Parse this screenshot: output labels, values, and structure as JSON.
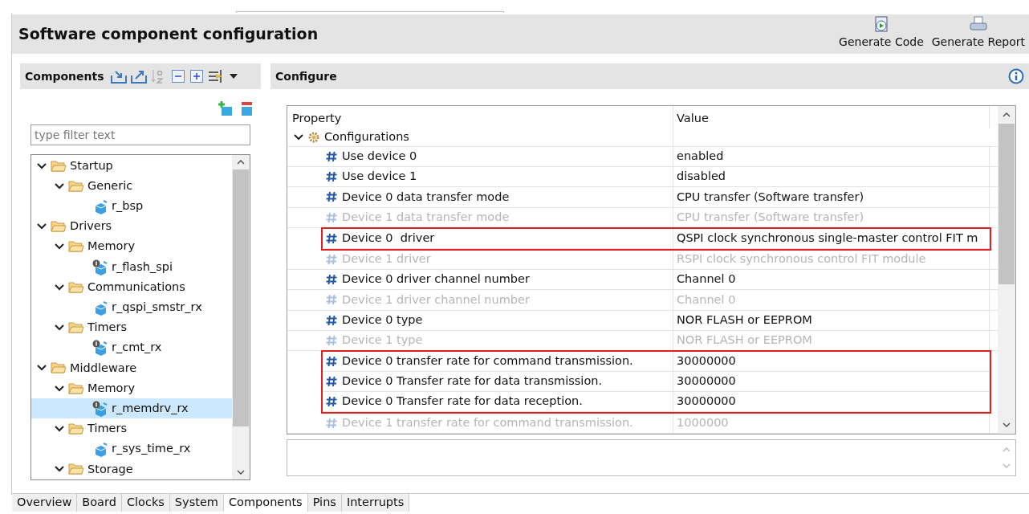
{
  "header": {
    "title": "Software component configuration",
    "actions": [
      {
        "label": "Generate Code",
        "kind": "code"
      },
      {
        "label": "Generate Report",
        "kind": "report"
      }
    ]
  },
  "components_panel": {
    "title": "Components",
    "filter": {
      "placeholder": "type filter text"
    },
    "tree": [
      {
        "label": "Startup",
        "kind": "folder",
        "expanded": true,
        "selected": false,
        "children": [
          {
            "label": "Generic",
            "kind": "folder",
            "expanded": true,
            "selected": false,
            "children": [
              {
                "label": "r_bsp",
                "kind": "component",
                "badge": false,
                "selected": false
              }
            ]
          }
        ]
      },
      {
        "label": "Drivers",
        "kind": "folder",
        "expanded": true,
        "selected": false,
        "children": [
          {
            "label": "Memory",
            "kind": "folder",
            "expanded": true,
            "selected": false,
            "children": [
              {
                "label": "r_flash_spi",
                "kind": "component",
                "badge": true,
                "selected": false
              }
            ]
          },
          {
            "label": "Communications",
            "kind": "folder",
            "expanded": true,
            "selected": false,
            "children": [
              {
                "label": "r_qspi_smstr_rx",
                "kind": "component",
                "badge": false,
                "selected": false
              }
            ]
          },
          {
            "label": "Timers",
            "kind": "folder",
            "expanded": true,
            "selected": false,
            "children": [
              {
                "label": "r_cmt_rx",
                "kind": "component",
                "badge": true,
                "selected": false
              }
            ]
          }
        ]
      },
      {
        "label": "Middleware",
        "kind": "folder",
        "expanded": true,
        "selected": false,
        "children": [
          {
            "label": "Memory",
            "kind": "folder",
            "expanded": true,
            "selected": false,
            "children": [
              {
                "label": "r_memdrv_rx",
                "kind": "component",
                "badge": true,
                "selected": true
              }
            ]
          },
          {
            "label": "Timers",
            "kind": "folder",
            "expanded": true,
            "selected": false,
            "children": [
              {
                "label": "r_sys_time_rx",
                "kind": "component",
                "badge": false,
                "selected": false
              }
            ]
          },
          {
            "label": "Storage",
            "kind": "folder",
            "expanded": true,
            "selected": false
          }
        ]
      }
    ]
  },
  "configure_panel": {
    "title": "Configure",
    "columns": [
      "Property",
      "Value"
    ],
    "group": {
      "label": "Configurations",
      "expanded": true
    },
    "rows": [
      {
        "property": "Use device 0",
        "value": "enabled",
        "disabled": false,
        "highlighted": false
      },
      {
        "property": "Use device 1",
        "value": "disabled",
        "disabled": false,
        "highlighted": false
      },
      {
        "property": "Device 0 data transfer mode",
        "value": "CPU transfer (Software transfer)",
        "disabled": false,
        "highlighted": false
      },
      {
        "property": "Device 1 data transfer mode",
        "value": "CPU transfer (Software transfer)",
        "disabled": true,
        "highlighted": false
      },
      {
        "property": "Device 0  driver",
        "value": "QSPI clock synchronous single-master control FIT m",
        "disabled": false,
        "highlighted": true
      },
      {
        "property": "Device 1 driver",
        "value": "RSPI clock synchronous control FIT module",
        "disabled": true,
        "highlighted": false
      },
      {
        "property": "Device 0 driver channel number",
        "value": "Channel 0",
        "disabled": false,
        "highlighted": false
      },
      {
        "property": "Device 1 driver channel number",
        "value": "Channel 0",
        "disabled": true,
        "highlighted": false
      },
      {
        "property": "Device 0 type",
        "value": "NOR FLASH or EEPROM",
        "disabled": false,
        "highlighted": false
      },
      {
        "property": "Device 1 type",
        "value": "NOR FLASH or EEPROM",
        "disabled": true,
        "highlighted": false
      },
      {
        "property": "Device 0 transfer rate for command transmission.",
        "value": "30000000",
        "disabled": false,
        "highlighted": true
      },
      {
        "property": "Device 0 Transfer rate for data transmission.",
        "value": "30000000",
        "disabled": false,
        "highlighted": true
      },
      {
        "property": "Device 0 Transfer rate for data reception.",
        "value": "30000000",
        "disabled": false,
        "highlighted": true
      },
      {
        "property": "Device 1 transfer rate for command transmission.",
        "value": "1000000",
        "disabled": true,
        "highlighted": false
      }
    ]
  },
  "bottom_tabs": [
    {
      "label": "Overview",
      "selected": false
    },
    {
      "label": "Board",
      "selected": false
    },
    {
      "label": "Clocks",
      "selected": false
    },
    {
      "label": "System",
      "selected": false
    },
    {
      "label": "Components",
      "selected": true
    },
    {
      "label": "Pins",
      "selected": false
    },
    {
      "label": "Interrupts",
      "selected": false
    }
  ]
}
